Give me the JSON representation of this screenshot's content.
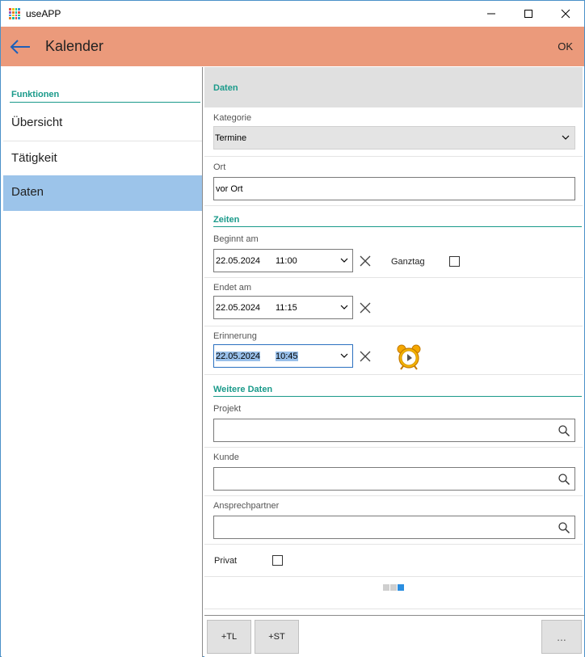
{
  "window": {
    "title": "useAPP",
    "icon_colors": [
      "#e84c3d",
      "#f1c40f",
      "#2ecc71",
      "#3498db",
      "#9b59b6",
      "#e67e22",
      "#1abc9c",
      "#e84c3d",
      "#3498db",
      "#f1c40f",
      "#9b59b6",
      "#2ecc71",
      "#e67e22",
      "#1abc9c",
      "#e84c3d",
      "#3498db"
    ]
  },
  "header": {
    "title": "Kalender",
    "ok_label": "OK",
    "bg_color": "#eb9a7b"
  },
  "sidebar": {
    "heading": "Funktionen",
    "items": [
      {
        "label": "Übersicht",
        "active": false
      },
      {
        "label": "Tätigkeit",
        "active": false
      },
      {
        "label": "Daten",
        "active": true
      }
    ]
  },
  "main": {
    "section_title": "Daten",
    "kategorie": {
      "label": "Kategorie",
      "value": "Termine"
    },
    "ort": {
      "label": "Ort",
      "value": "vor Ort"
    },
    "zeiten": {
      "heading": "Zeiten",
      "beginnt": {
        "label": "Beginnt am",
        "date": "22.05.2024",
        "time": "11:00"
      },
      "ganztag_label": "Ganztag",
      "endet": {
        "label": "Endet am",
        "date": "22.05.2024",
        "time": "11:15"
      },
      "erinnerung": {
        "label": "Erinnerung",
        "date": "22.05.2024",
        "time": "10:45"
      }
    },
    "weitere": {
      "heading": "Weitere Daten",
      "projekt_label": "Projekt",
      "kunde_label": "Kunde",
      "ansprechpartner_label": "Ansprechpartner",
      "privat_label": "Privat"
    },
    "pager": {
      "count": 3,
      "active_index": 2
    }
  },
  "bottom": {
    "tl_label": "+TL",
    "st_label": "+ST",
    "more_label": "..."
  }
}
